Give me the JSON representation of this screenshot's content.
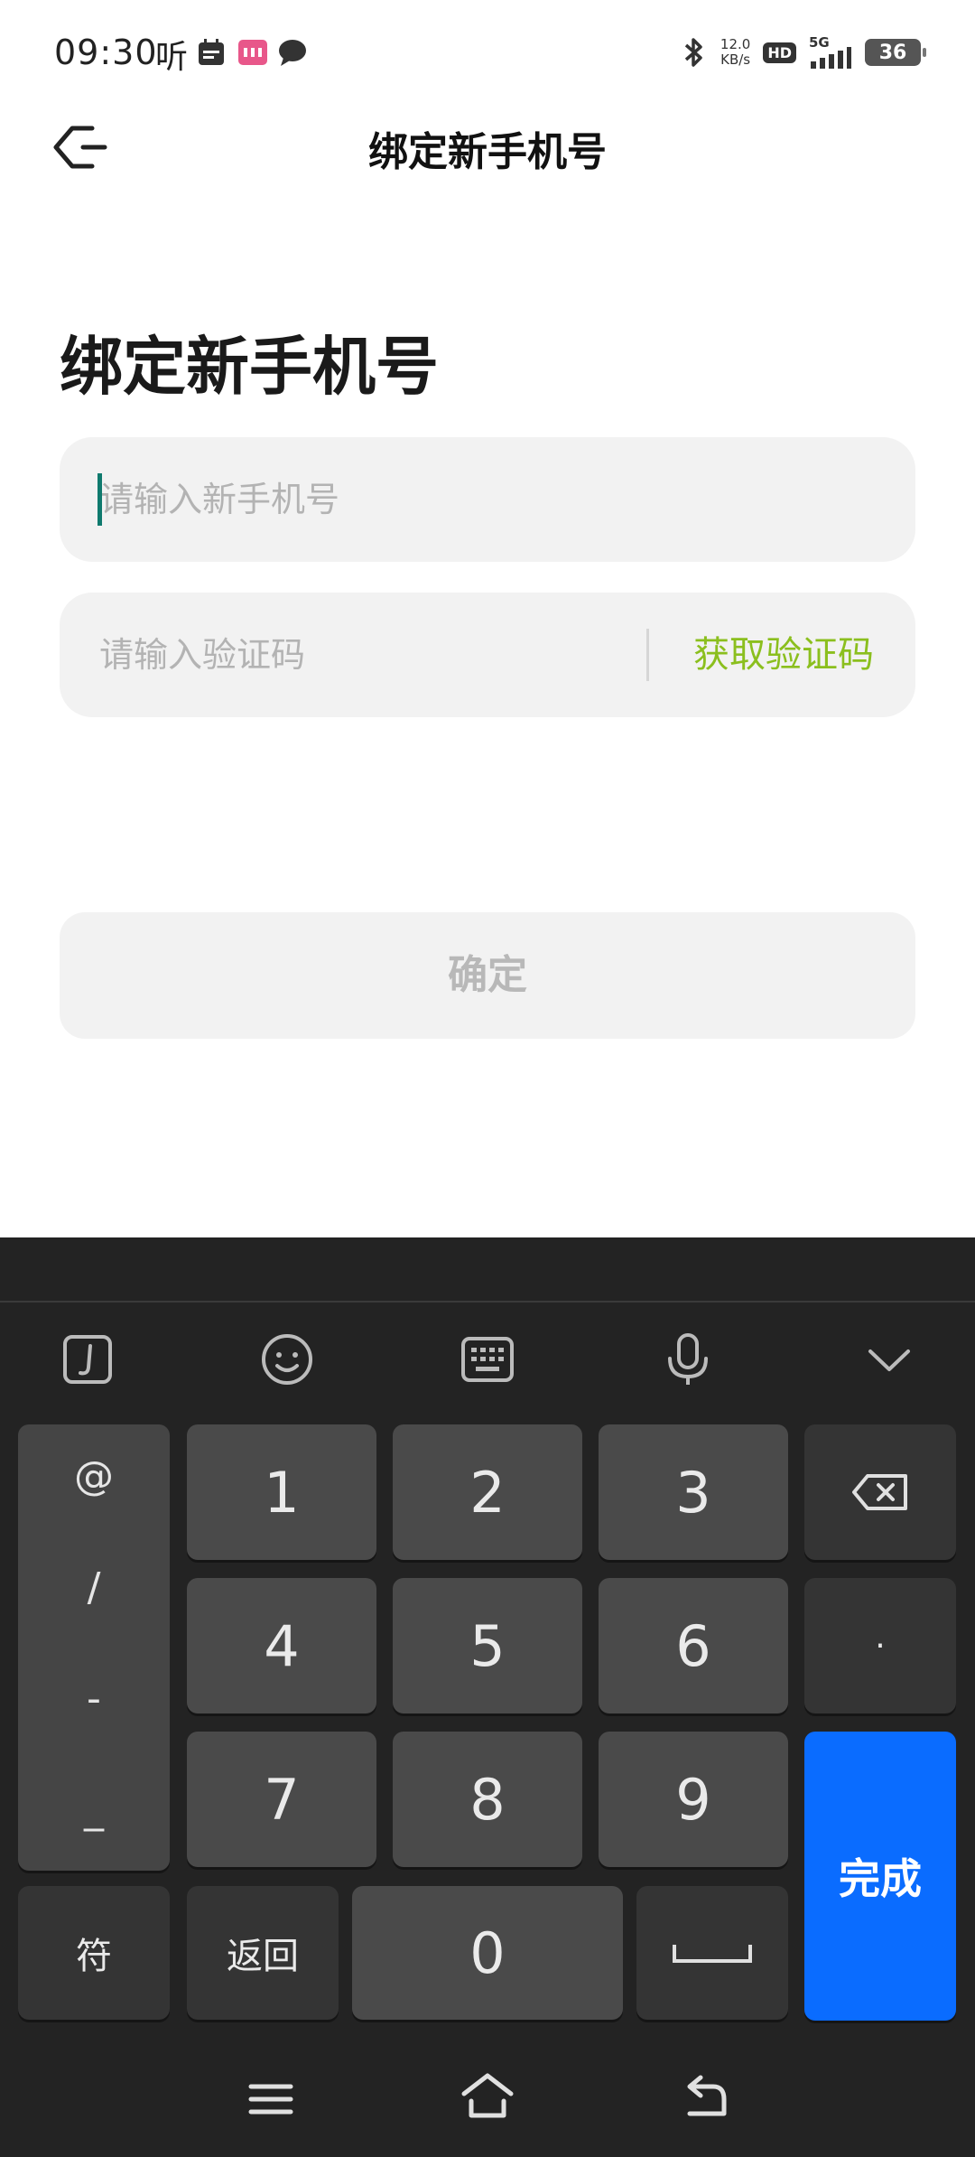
{
  "status_bar": {
    "time": "09:30",
    "ting_label": "听",
    "net_speed_value": "12.0",
    "net_speed_unit": "KB/s",
    "hd_label": "HD",
    "network_label": "5G",
    "battery_level": "36"
  },
  "header": {
    "title": "绑定新手机号"
  },
  "page": {
    "heading": "绑定新手机号"
  },
  "form": {
    "phone_placeholder": "请输入新手机号",
    "code_placeholder": "请输入验证码",
    "get_code_label": "获取验证码",
    "confirm_label": "确定",
    "accent_color": "#8bbf1e",
    "caret_color": "#0f7a6e"
  },
  "keyboard": {
    "toolbar": [
      "handwriting-icon",
      "emoji-icon",
      "keyboard-icon",
      "microphone-icon",
      "chevron-down-icon"
    ],
    "symbols": [
      "@",
      "/",
      "-",
      "_"
    ],
    "digits": [
      "1",
      "2",
      "3",
      "4",
      "5",
      "6",
      "7",
      "8",
      "9",
      "0"
    ],
    "dot_label": "·",
    "fu_label": "符",
    "return_label": "返回",
    "done_label": "完成",
    "done_color": "#0a6cff"
  },
  "nav_bar": {
    "icons": [
      "menu-icon",
      "home-icon",
      "back-nav-icon"
    ]
  }
}
